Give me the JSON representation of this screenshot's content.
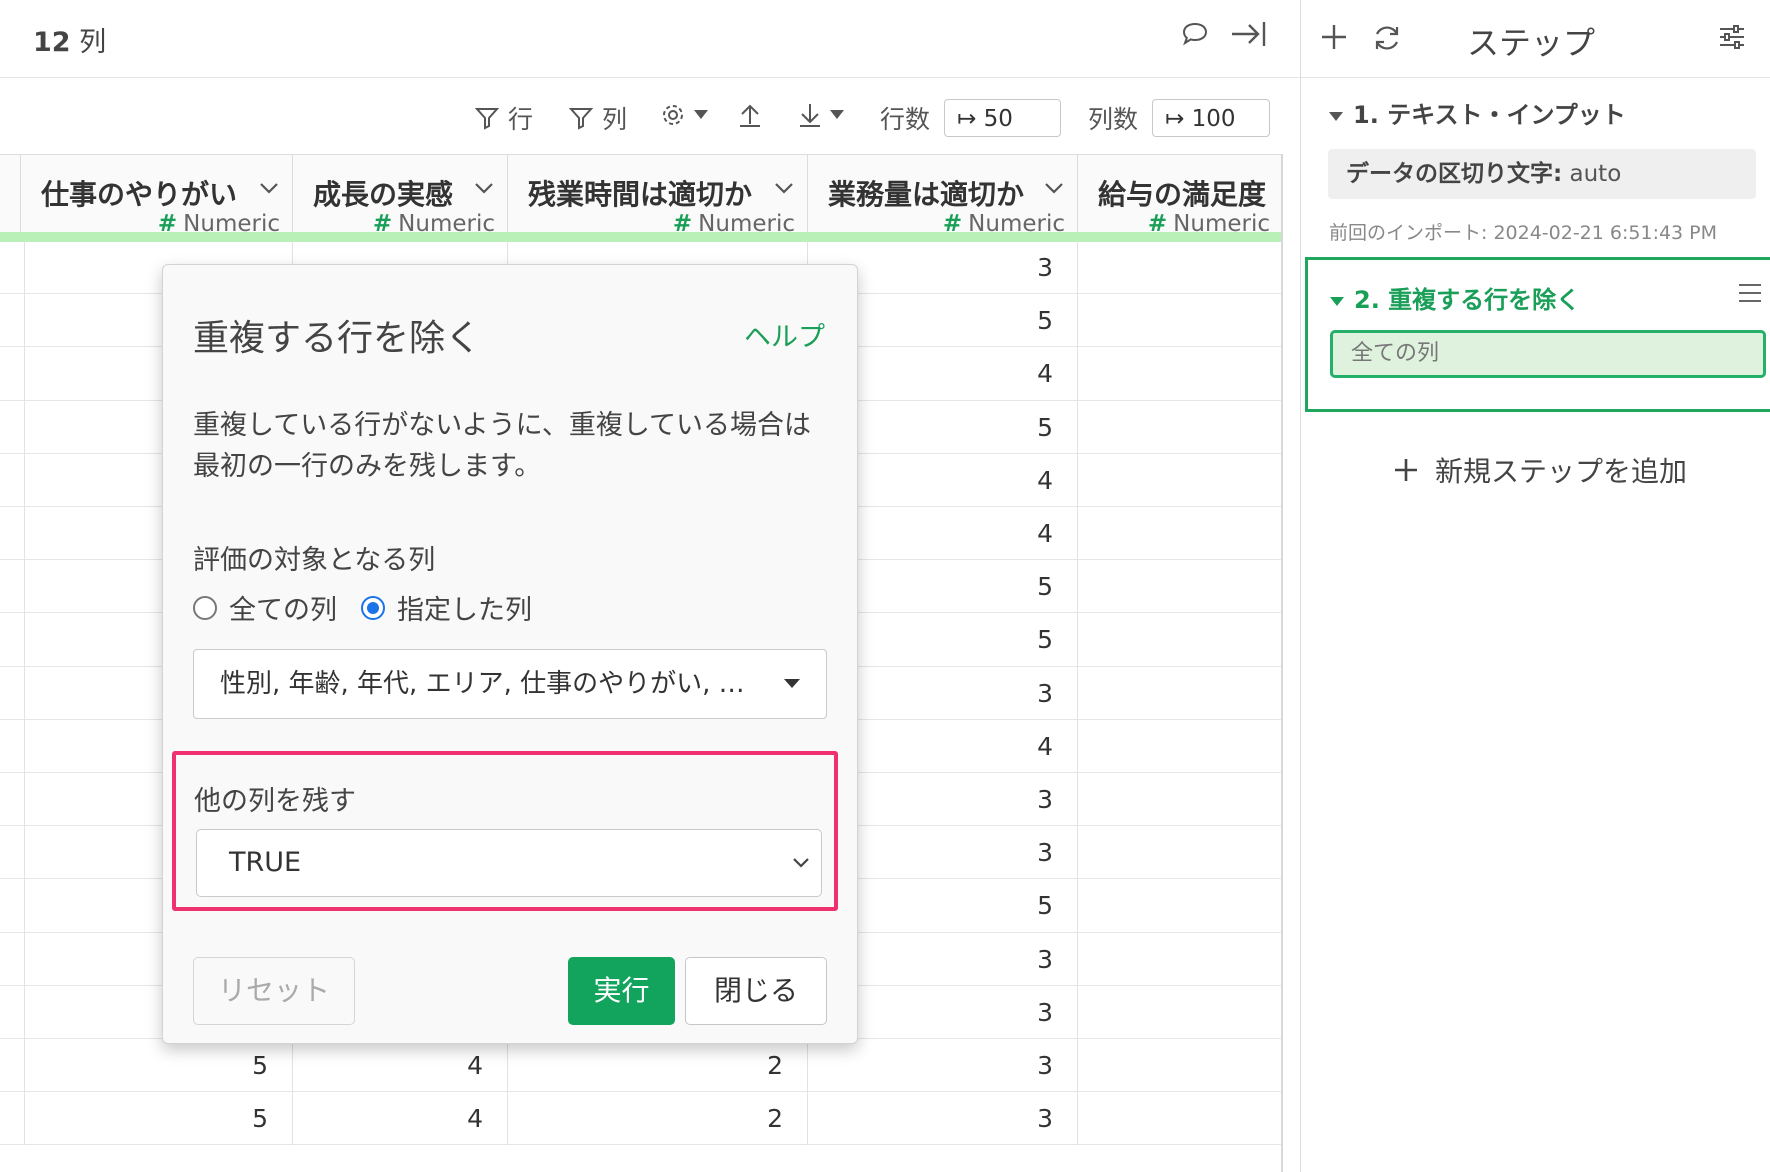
{
  "topbar": {
    "column_count_number": "12",
    "column_count_unit": "列"
  },
  "toolbar": {
    "row_filter_label": "行",
    "col_filter_label": "列",
    "rows_label": "行数",
    "rows_value": "50",
    "cols_label": "列数",
    "cols_value": "100"
  },
  "grid": {
    "type_label": "Numeric",
    "columns": [
      {
        "name": ""
      },
      {
        "name": "仕事のやりがい"
      },
      {
        "name": "成長の実感"
      },
      {
        "name": "残業時間は適切か"
      },
      {
        "name": "業務量は適切か"
      },
      {
        "name": "給与の満足度"
      }
    ],
    "col4_values": [
      "3",
      "5",
      "4",
      "5",
      "4",
      "4",
      "5",
      "5",
      "3",
      "4",
      "3",
      "3",
      "5",
      "3",
      "3"
    ],
    "rows_bottom": [
      {
        "c1": "5",
        "c2": "4",
        "c3": "2",
        "c4": "3"
      },
      {
        "c1": "5",
        "c2": "4",
        "c3": "2",
        "c4": "3"
      }
    ]
  },
  "steps": {
    "title": "ステップ",
    "step1": {
      "title": "1. テキスト・インプット",
      "param_label": "データの区切り文字:",
      "param_value": "auto",
      "meta": "前回のインポート: 2024-02-21 6:51:43 PM"
    },
    "step2": {
      "title": "2. 重複する行を除く",
      "param": "全ての列"
    },
    "add_step": "新規ステップを追加"
  },
  "dialog": {
    "title": "重複する行を除く",
    "help": "ヘルプ",
    "description": "重複している行がないように、重複している場合は最初の一行のみを残します。",
    "eval_label": "評価の対象となる列",
    "radio_all": "全ての列",
    "radio_selected": "指定した列",
    "columns_value": "性別, 年齢, 年代, エリア, 仕事のやりがい, …",
    "keep_label": "他の列を残す",
    "keep_value": "TRUE",
    "reset": "リセット",
    "run": "実行",
    "close": "閉じる"
  },
  "colors": {
    "accent": "#1a9f58",
    "highlight": "#f0316f",
    "radio": "#1a73e8"
  }
}
